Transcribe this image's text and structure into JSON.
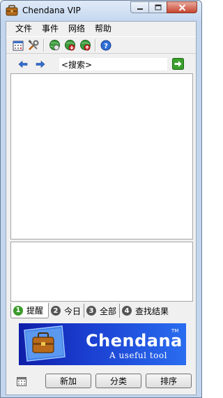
{
  "window": {
    "title": "Chendana VIP",
    "controls": [
      "minimize",
      "maximize",
      "close"
    ]
  },
  "menu": [
    "文件",
    "事件",
    "网络",
    "帮助"
  ],
  "toolbar": {
    "icons": [
      "calendar-icon",
      "tools-icon",
      "globe-icon",
      "globe-download-icon",
      "globe-upload-icon",
      "help-icon"
    ]
  },
  "nav": {
    "back_icon": "arrow-left-icon",
    "forward_icon": "arrow-right-icon",
    "search_value": "<搜索>",
    "go_icon": "go-arrow-icon"
  },
  "tabs": [
    {
      "num": "1",
      "label": "提醒",
      "active": true
    },
    {
      "num": "2",
      "label": "今日",
      "active": false
    },
    {
      "num": "3",
      "label": "全部",
      "active": false
    },
    {
      "num": "4",
      "label": "查找结果",
      "active": false
    }
  ],
  "banner": {
    "brand": "Chendana",
    "tm": "TM",
    "slogan": "A useful tool"
  },
  "buttons": {
    "add": "新加",
    "category": "分类",
    "sort": "排序"
  },
  "colors": {
    "accent_blue": "#1a3ed0",
    "tab_active_number": "#3a9a2a"
  }
}
